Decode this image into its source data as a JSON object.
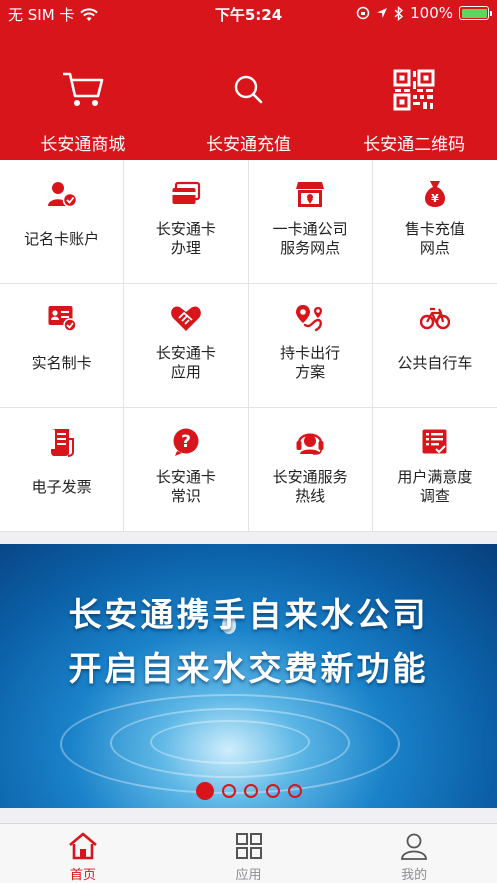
{
  "status_bar": {
    "carrier": "无 SIM 卡",
    "time": "下午5:24",
    "battery_percent": "100%"
  },
  "top_actions": [
    {
      "label": "长安通商城",
      "icon": "cart-icon"
    },
    {
      "label": "长安通充值",
      "icon": "search-icon"
    },
    {
      "label": "长安通二维码",
      "icon": "qr-code-icon"
    }
  ],
  "grid": [
    {
      "label": "记名卡账户",
      "icon": "account-card-icon"
    },
    {
      "label": "长安通卡\n办理",
      "icon": "card-apply-icon"
    },
    {
      "label": "一卡通公司\n服务网点",
      "icon": "service-store-icon"
    },
    {
      "label": "售卡充值\n网点",
      "icon": "money-bag-icon"
    },
    {
      "label": "实名制卡",
      "icon": "id-card-icon"
    },
    {
      "label": "长安通卡\n应用",
      "icon": "handshake-icon"
    },
    {
      "label": "持卡出行\n方案",
      "icon": "route-icon"
    },
    {
      "label": "公共自行车",
      "icon": "bicycle-icon"
    },
    {
      "label": "电子发票",
      "icon": "invoice-icon"
    },
    {
      "label": "长安通卡\n常识",
      "icon": "question-icon"
    },
    {
      "label": "长安通服务\n热线",
      "icon": "headset-icon"
    },
    {
      "label": "用户满意度\n调查",
      "icon": "survey-icon"
    }
  ],
  "banner": {
    "line1": "长安通携手自来水公司",
    "line2": "开启自来水交费新功能",
    "slide_count": 5,
    "active_slide": 1
  },
  "tabbar": [
    {
      "label": "首页",
      "icon": "home-icon",
      "active": true
    },
    {
      "label": "应用",
      "icon": "apps-icon",
      "active": false
    },
    {
      "label": "我的",
      "icon": "profile-icon",
      "active": false
    }
  ],
  "colors": {
    "brand": "#d9151c",
    "tab_inactive": "#8e8e93"
  }
}
